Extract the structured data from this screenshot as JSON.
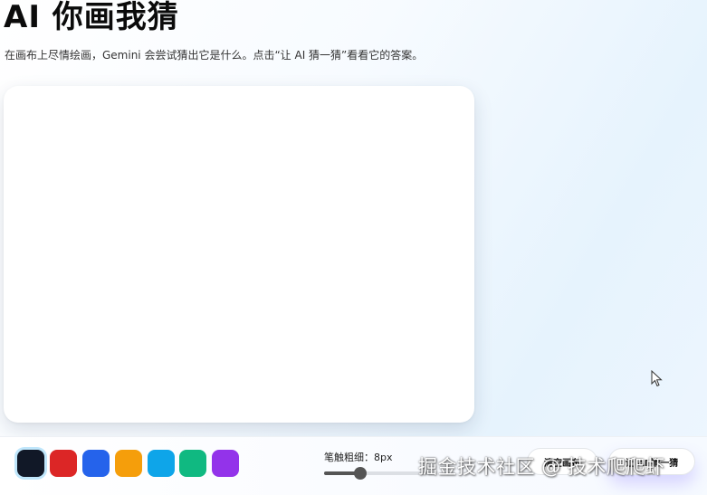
{
  "header": {
    "title": "AI 你画我猜",
    "subtitle": "在画布上尽情绘画，Gemini 会尝试猜出它是什么。点击“让 AI 猜一猜”看看它的答案。"
  },
  "toolbar": {
    "colors": [
      {
        "name": "black",
        "hex": "#111827",
        "selected": true
      },
      {
        "name": "red",
        "hex": "#dc2626",
        "selected": false
      },
      {
        "name": "blue",
        "hex": "#2563eb",
        "selected": false
      },
      {
        "name": "orange",
        "hex": "#f59e0b",
        "selected": false
      },
      {
        "name": "sky",
        "hex": "#0ea5e9",
        "selected": false
      },
      {
        "name": "green",
        "hex": "#10b981",
        "selected": false
      },
      {
        "name": "purple",
        "hex": "#9333ea",
        "selected": false
      }
    ],
    "brush_label": "笔触粗细：8px",
    "brush_level": 0.33,
    "clear_label": "清空画布",
    "guess_label": "让 AI 猜一猜"
  },
  "watermark": "掘金技术社区 @ 技术爬爬虾"
}
